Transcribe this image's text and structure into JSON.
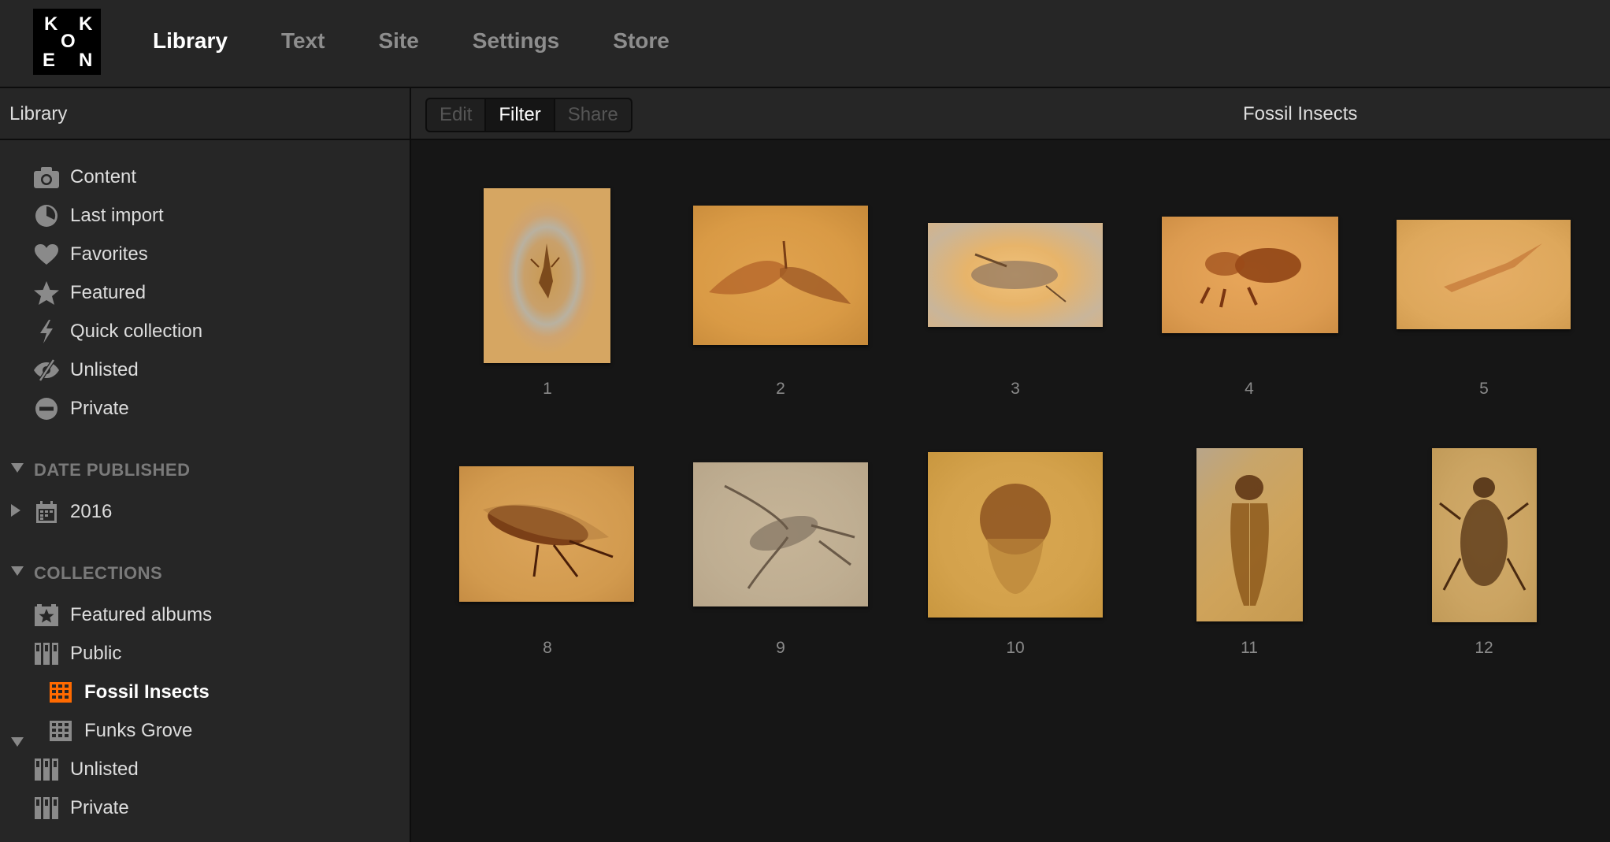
{
  "nav": {
    "logo_letters": [
      "K",
      "K",
      "O",
      "E",
      "N"
    ],
    "items": [
      "Library",
      "Text",
      "Site",
      "Settings",
      "Store"
    ],
    "active": "Library"
  },
  "sidebar": {
    "header": "Library",
    "library_items": [
      {
        "label": "Content",
        "icon": "camera-icon"
      },
      {
        "label": "Last import",
        "icon": "clock-icon"
      },
      {
        "label": "Favorites",
        "icon": "heart-icon"
      },
      {
        "label": "Featured",
        "icon": "star-icon"
      },
      {
        "label": "Quick collection",
        "icon": "lightning-icon"
      },
      {
        "label": "Unlisted",
        "icon": "hidden-eye-icon"
      },
      {
        "label": "Private",
        "icon": "minus-circle-icon"
      }
    ],
    "date_section": "DATE PUBLISHED",
    "date_items": [
      {
        "label": "2016",
        "icon": "calendar-icon"
      }
    ],
    "collections_section": "COLLECTIONS",
    "collection_items": [
      {
        "label": "Featured albums",
        "icon": "featured-album-icon"
      },
      {
        "label": "Public",
        "icon": "set-icon"
      },
      {
        "label": "Fossil Insects",
        "icon": "album-grid-icon",
        "selected": true
      },
      {
        "label": "Funks Grove",
        "icon": "album-grid-icon"
      },
      {
        "label": "Unlisted",
        "icon": "set-icon"
      },
      {
        "label": "Private",
        "icon": "set-icon"
      }
    ],
    "accent_color": "#ff6a00"
  },
  "toolbar": {
    "buttons": [
      "Edit",
      "Filter",
      "Share"
    ],
    "active_button": "Filter",
    "album_title": "Fossil Insects"
  },
  "grid": {
    "items": [
      {
        "number": "1"
      },
      {
        "number": "2"
      },
      {
        "number": "3"
      },
      {
        "number": "4"
      },
      {
        "number": "5"
      },
      {
        "number": "8"
      },
      {
        "number": "9"
      },
      {
        "number": "10"
      },
      {
        "number": "11"
      },
      {
        "number": "12"
      }
    ]
  }
}
